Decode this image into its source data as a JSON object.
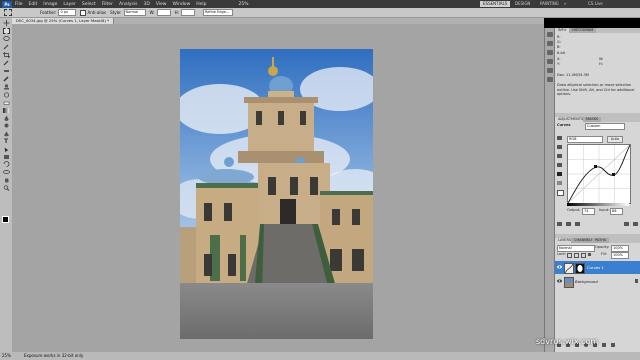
{
  "app": {
    "logo": "Ps"
  },
  "menu": [
    "File",
    "Edit",
    "Image",
    "Layer",
    "Select",
    "Filter",
    "Analysis",
    "3D",
    "View",
    "Window",
    "Help"
  ],
  "workspace": {
    "active": "ESSENTIALS",
    "others": [
      "DESIGN",
      "PAINTING"
    ],
    "more": "»",
    "cslive": "CS Live"
  },
  "options": {
    "feather_label": "Feather:",
    "feather_value": "0 px",
    "antialias_label": "Anti-alias",
    "style_label": "Style:",
    "style_value": "Normal",
    "width_label": "W:",
    "height_label": "H:",
    "refine_label": "Refine Edge..."
  },
  "document": {
    "tab_title": "DSC_0034.jpg @ 25% (Curves 1, Layer Mask/8) *",
    "zoom": "25%",
    "status": "Exposure works in 32-bit only"
  },
  "info_panel": {
    "tabs": [
      "INFO",
      "HISTOGRAM"
    ],
    "labels": [
      "R:",
      "G:",
      "B:",
      "8-bit",
      "X:",
      "Y:",
      "W:",
      "H:"
    ],
    "doc": "Doc: 11.4M/34.3M",
    "hint": "Draw elliptical selection or move selection outline. Use Shift, Alt, and Ctrl for additional options."
  },
  "adjustments_panel": {
    "tabs": [
      "ADJUSTMENTS",
      "MASKS"
    ],
    "title": "Curves",
    "preset": "Custom",
    "channel": "RGB",
    "auto": "Auto",
    "output_label": "Output:",
    "output_value": "74",
    "input_label": "Input:",
    "input_value": "86"
  },
  "layers_panel": {
    "tabs": [
      "LAYERS",
      "CHANNELS",
      "PATHS"
    ],
    "blend": "Normal",
    "opacity_label": "Opacity:",
    "opacity": "100%",
    "lock_label": "Lock:",
    "fill_label": "Fill:",
    "fill": "100%",
    "layers": [
      {
        "name": "Curves 1",
        "selected": true
      },
      {
        "name": "Background",
        "selected": false
      }
    ]
  },
  "watermark": "sdvrus.wix.com",
  "tool_icons": [
    "move-tool-icon",
    "marquee-tool-icon",
    "lasso-tool-icon",
    "quick-select-tool-icon",
    "crop-tool-icon",
    "eyedropper-tool-icon",
    "healing-brush-tool-icon",
    "brush-tool-icon",
    "clone-stamp-tool-icon",
    "history-brush-tool-icon",
    "eraser-tool-icon",
    "gradient-tool-icon",
    "blur-tool-icon",
    "dodge-tool-icon",
    "pen-tool-icon",
    "type-tool-icon",
    "path-select-tool-icon",
    "shape-tool-icon",
    "3d-rotate-tool-icon",
    "3d-orbit-tool-icon",
    "hand-tool-icon",
    "zoom-tool-icon"
  ],
  "colors": {
    "accent": "#3b7fd1",
    "canvas": "#a4a4a4",
    "panel": "#d6d6d6"
  }
}
